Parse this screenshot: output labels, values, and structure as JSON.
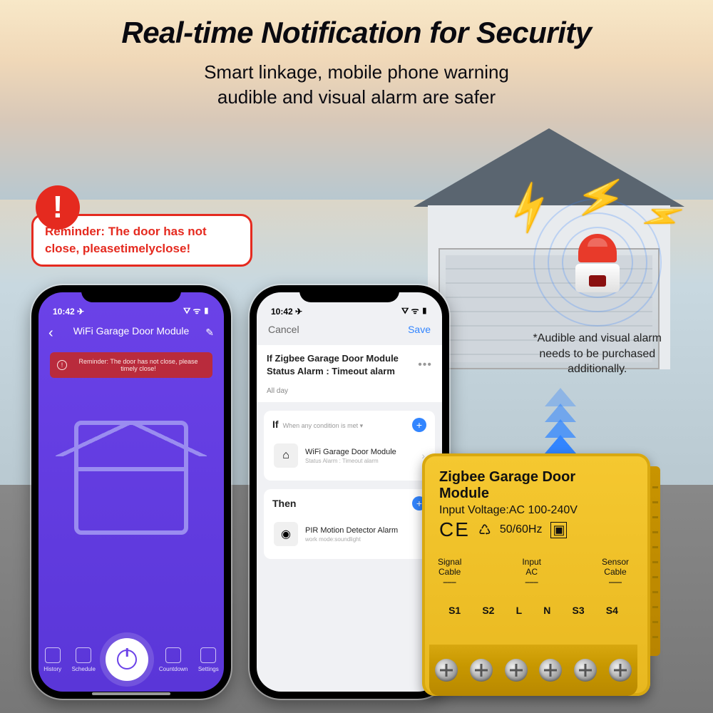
{
  "heading": {
    "title": "Real-time Notification for Security",
    "subtitle_l1": "Smart linkage, mobile phone warning",
    "subtitle_l2": "audible and visual alarm are safer"
  },
  "reminder": {
    "badge": "!",
    "text": "Reminder: The door has not close, pleasetimelyclose!"
  },
  "phone1": {
    "status_time": "10:42 ✈",
    "wifi": "⛛ ᯤ ▮",
    "title": "WiFi Garage Door Module",
    "edit_icon": "✎",
    "alert": "Reminder: The door has not close, please timely close!",
    "nav": {
      "history": "History",
      "schedule": "Schedule",
      "countdown": "Countdown",
      "settings": "Settings"
    }
  },
  "phone2": {
    "cancel": "Cancel",
    "save": "Save",
    "rule_title": "If Zigbee Garage Door Module Status Alarm : Timeout alarm",
    "all_day": "All day",
    "if_label": "If",
    "if_sub": "When any condition is met ▾",
    "cond_name": "WiFi Garage Door Module",
    "cond_desc": "Status Alarm : Timeout alarm",
    "then_label": "Then",
    "act_name": "PIR Motion Detector Alarm",
    "act_desc": "work mode:soundlight"
  },
  "alarm_note": {
    "l1": "*Audible and visual alarm",
    "l2": "needs to be purchased",
    "l3": "additionally."
  },
  "module": {
    "title": "Zigbee Garage Door Module",
    "voltage": "Input Voltage:AC 100-240V",
    "hz": "50/60Hz",
    "ce": "CE",
    "cables": {
      "signal": "Signal\nCable",
      "input": "Input\nAC",
      "sensor": "Sensor\nCable"
    },
    "terminals": [
      "S1",
      "S2",
      "L",
      "N",
      "S3",
      "S4"
    ]
  }
}
